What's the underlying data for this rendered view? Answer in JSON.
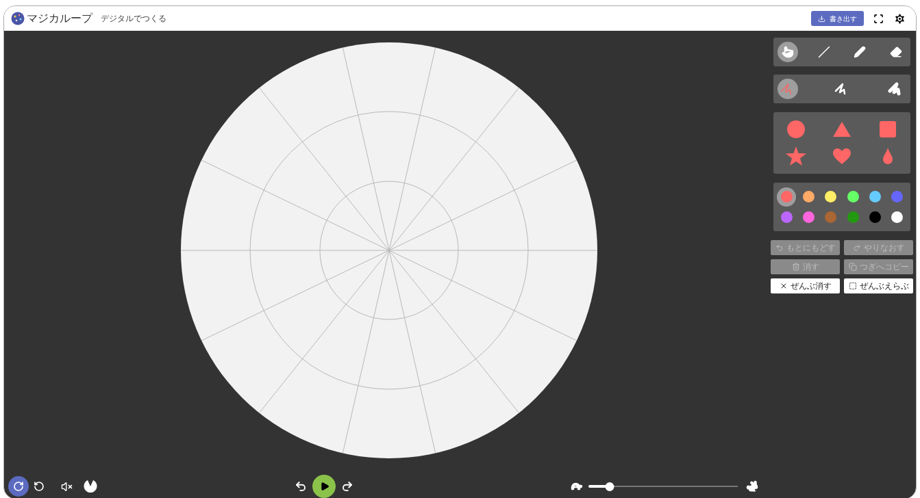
{
  "header": {
    "logo": "マジカループ",
    "subtitle": "デジタルでつくる",
    "export_button": "書き出す"
  },
  "tools": [
    {
      "kind": "touch",
      "selected": true
    },
    {
      "kind": "line",
      "selected": false
    },
    {
      "kind": "pencil",
      "selected": false
    },
    {
      "kind": "eraser",
      "selected": false
    }
  ],
  "strokes": [
    {
      "kind": "thin",
      "selected": true
    },
    {
      "kind": "medium",
      "selected": false
    },
    {
      "kind": "thick",
      "selected": false
    }
  ],
  "shapes": [
    {
      "kind": "circle"
    },
    {
      "kind": "triangle"
    },
    {
      "kind": "square"
    },
    {
      "kind": "star"
    },
    {
      "kind": "heart"
    },
    {
      "kind": "drop"
    }
  ],
  "colors": [
    {
      "color": "#ff6666",
      "selected": true
    },
    {
      "color": "#ffaa66",
      "selected": false
    },
    {
      "color": "#ffee66",
      "selected": false
    },
    {
      "color": "#66ff66",
      "selected": false
    },
    {
      "color": "#66ccff",
      "selected": false
    },
    {
      "color": "#6666ff",
      "selected": false
    },
    {
      "color": "#bb66ff",
      "selected": false
    },
    {
      "color": "#ff66dd",
      "selected": false
    },
    {
      "color": "#aa6633",
      "selected": false
    },
    {
      "color": "#229911",
      "selected": false
    },
    {
      "color": "#000000",
      "selected": false
    },
    {
      "color": "#ffffff",
      "selected": false
    }
  ],
  "actions": [
    {
      "kind": "undo",
      "label": "もとにもどす",
      "disabled": true
    },
    {
      "kind": "redo",
      "label": "やりなおす",
      "disabled": true
    },
    {
      "kind": "delete",
      "label": "消す",
      "disabled": true
    },
    {
      "kind": "copy",
      "label": "つぎへコピー",
      "disabled": true
    },
    {
      "kind": "clear",
      "label": "ぜんぶ消す",
      "disabled": false
    },
    {
      "kind": "select",
      "label": "ぜんぶえらぶ",
      "disabled": false
    }
  ],
  "playback": {
    "modes": [
      {
        "kind": "loop",
        "selected": true
      },
      {
        "kind": "once",
        "selected": false
      }
    ],
    "muted": true,
    "speed": {
      "level": 0.14
    }
  }
}
